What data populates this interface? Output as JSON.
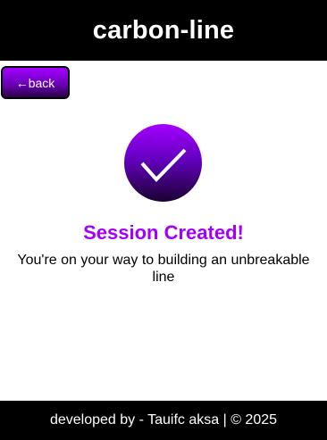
{
  "header": {
    "title": "carbon-line"
  },
  "nav": {
    "back_label": "←back"
  },
  "status": {
    "icon": "checkmark-icon",
    "title": "Session Created!",
    "message": "You're on your way to building an unbreakable line"
  },
  "footer": {
    "text": "developed by - Tauifc aksa | © 2025"
  },
  "colors": {
    "accent": "#a100ff",
    "header_bg": "#000000",
    "footer_bg": "#000000"
  }
}
